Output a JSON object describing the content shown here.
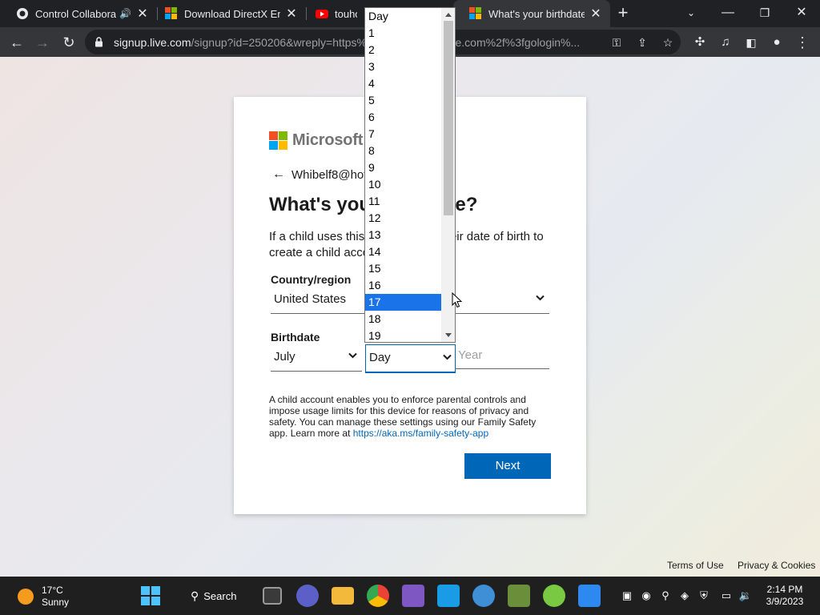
{
  "browser": {
    "tabs": [
      {
        "title": "Control Collaborati",
        "favicon": "github-icon"
      },
      {
        "title": "Download DirectX End-",
        "favicon": "microsoft-icon"
      },
      {
        "title": "touhou",
        "favicon": "youtube-icon"
      },
      {
        "title": "What's your birthdate?",
        "favicon": "microsoft-icon"
      }
    ],
    "url_host": "signup.live.com",
    "url_rest": "/signup?id=250206&wreply=https%3a%2f%2flogin.live.com%2f%3fgologin%..."
  },
  "page": {
    "brand": "Microsoft",
    "identity": "Whibelf8@hotmail.com",
    "heading": "What's your birthdate?",
    "description": "If a child uses this device, enter their date of birth to create a child account.",
    "country_label": "Country/region",
    "country_value": "United States",
    "birthdate_label": "Birthdate",
    "month_value": "July",
    "day_value": "Day",
    "year_placeholder": "Year",
    "info_text": "A child account enables you to enforce parental controls and impose usage limits for this device for reasons of privacy and safety. You can manage these settings using our Family Safety app. Learn more at ",
    "info_link": "https://aka.ms/family-safety-app",
    "next_label": "Next",
    "terms_link": "Terms of Use",
    "privacy_link": "Privacy & Cookies"
  },
  "day_dropdown": {
    "options": [
      "Day",
      "1",
      "2",
      "3",
      "4",
      "5",
      "6",
      "7",
      "8",
      "9",
      "10",
      "11",
      "12",
      "13",
      "14",
      "15",
      "16",
      "17",
      "18",
      "19"
    ],
    "highlighted": "17"
  },
  "taskbar": {
    "temperature": "17°C",
    "condition": "Sunny",
    "search_label": "Search",
    "time": "2:14 PM",
    "date": "3/9/2023"
  },
  "colors": {
    "accent": "#0067b8",
    "dropdown_highlight": "#1a73e8"
  }
}
